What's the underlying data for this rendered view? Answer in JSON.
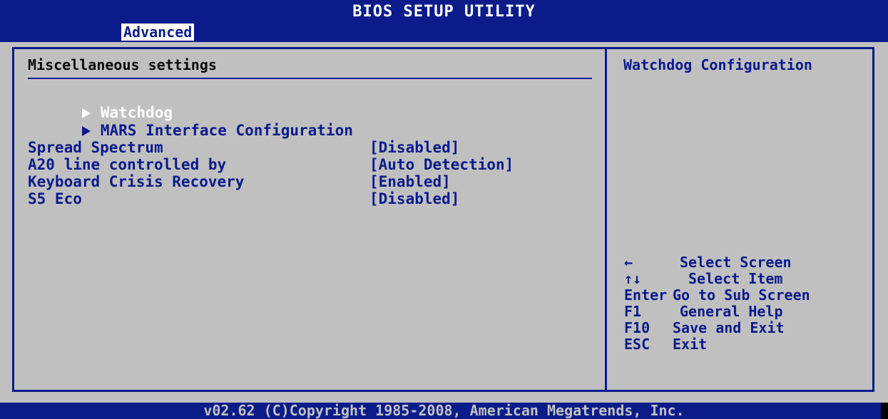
{
  "header": {
    "title": "BIOS SETUP UTILITY",
    "active_tab": "Advanced"
  },
  "main": {
    "section_title": "Miscellaneous settings",
    "submenus": [
      {
        "label": "Watchdog",
        "selected": true
      },
      {
        "label": "MARS Interface Configuration",
        "selected": false
      }
    ],
    "settings": [
      {
        "label": "Spread Spectrum",
        "value": "[Disabled]"
      },
      {
        "label": "A20 line controlled by",
        "value": "[Auto Detection]"
      },
      {
        "label": "Keyboard Crisis Recovery",
        "value": "[Enabled]"
      },
      {
        "label": "S5 Eco",
        "value": "[Disabled]"
      }
    ]
  },
  "help": {
    "title": "Watchdog Configuration",
    "keys": [
      {
        "key": "←",
        "desc": "Select Screen"
      },
      {
        "key": "↑↓",
        "desc": "Select Item"
      },
      {
        "key": "Enter",
        "desc": "Go to Sub Screen"
      },
      {
        "key": "F1",
        "desc": "General Help"
      },
      {
        "key": "F10",
        "desc": "Save and Exit"
      },
      {
        "key": "ESC",
        "desc": "Exit"
      }
    ]
  },
  "footer": {
    "text": "v02.62 (C)Copyright 1985-2008, American Megatrends, Inc."
  },
  "colors": {
    "bios_blue": "#0b1c8a",
    "panel_gray": "#c0c0c0",
    "highlight_white": "#ffffff"
  }
}
